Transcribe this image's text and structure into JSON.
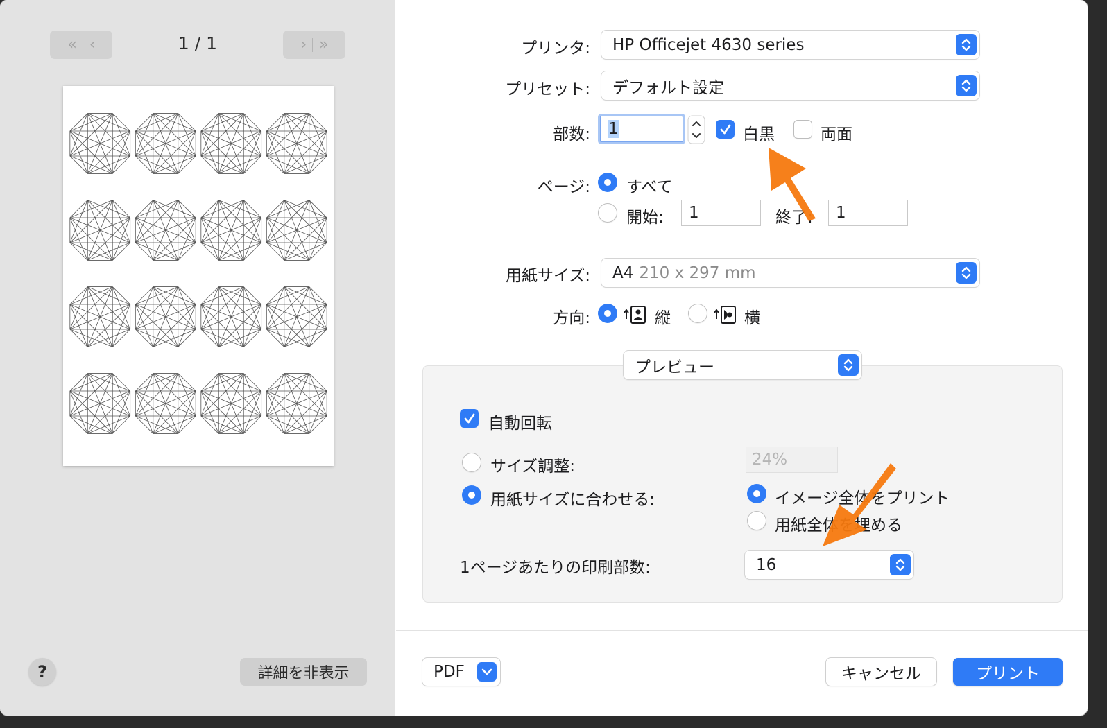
{
  "nav": {
    "first_prev_label": "«|‹",
    "next_last_label": "›|»",
    "page_count": "1 / 1"
  },
  "preview": {
    "thumbnails_per_page": 16
  },
  "left_footer": {
    "help_label": "?",
    "hide_details_label": "詳細を非表示"
  },
  "printer": {
    "label": "プリンタ:",
    "value": "HP Officejet 4630 series"
  },
  "preset": {
    "label": "プリセット:",
    "value": "デフォルト設定"
  },
  "copies": {
    "label": "部数:",
    "value": "1",
    "bw_label": "白黒",
    "bw_checked": true,
    "duplex_label": "両面",
    "duplex_checked": false
  },
  "pages": {
    "label": "ページ:",
    "all_label": "すべて",
    "from_label": "開始:",
    "from_value": "1",
    "to_label": "終了:",
    "to_value": "1"
  },
  "paper_size": {
    "label": "用紙サイズ:",
    "value": "A4",
    "detail": "210 x 297 mm"
  },
  "orientation": {
    "label": "方向:",
    "portrait_label": "縦",
    "landscape_label": "横"
  },
  "section_menu": {
    "value": "プレビュー"
  },
  "preview_options": {
    "auto_rotate_label": "自動回転",
    "auto_rotate_checked": true,
    "scale_label": "サイズ調整:",
    "scale_value": "24%",
    "fit_label": "用紙サイズに合わせる:",
    "print_entire_label": "イメージ全体をプリント",
    "fill_paper_label": "用紙全体を埋める",
    "copies_per_page_label": "1ページあたりの印刷部数:",
    "copies_per_page_value": "16"
  },
  "footer": {
    "pdf_label": "PDF",
    "cancel_label": "キャンセル",
    "print_label": "プリント"
  },
  "colors": {
    "accent": "#2f7bf6",
    "annotation_arrow": "#f5790f",
    "sidebar_bg": "#e3e3e3"
  }
}
